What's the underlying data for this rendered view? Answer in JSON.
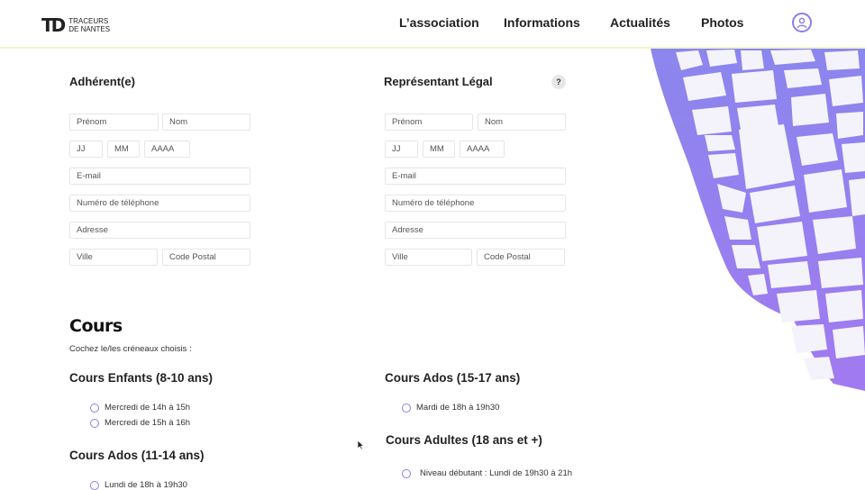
{
  "header": {
    "logo_mark": "TD",
    "logo_line1": "TRACEURS",
    "logo_line2": "DE NANTES",
    "nav": [
      "L’association",
      "Informations",
      "Actualités",
      "Photos"
    ]
  },
  "adherent": {
    "title": "Adhérent(e)",
    "prenom": "Prénom",
    "nom": "Nom",
    "jj": "JJ",
    "mm": "MM",
    "aaaa": "AAAA",
    "email": "E-mail",
    "telephone": "Numéro de téléphone",
    "adresse": "Adresse",
    "ville": "Ville",
    "code_postal": "Code Postal"
  },
  "representant": {
    "title": "Représentant Légal",
    "help": "?",
    "prenom": "Prénom",
    "nom": "Nom",
    "jj": "JJ",
    "mm": "MM",
    "aaaa": "AAAA",
    "email": "E-mail",
    "telephone": "Numéro de téléphone",
    "adresse": "Adresse",
    "ville": "Ville",
    "code_postal": "Code Postal"
  },
  "cours": {
    "title": "Cours",
    "subtitle": "Cochez le/les créneaux choisis :",
    "enfants": {
      "title": "Cours Enfants (8-10 ans)",
      "options": [
        "Mercredi de 14h à 15h",
        "Mercredi de 15h à 16h"
      ]
    },
    "ados_11": {
      "title": "Cours Ados (11-14 ans)",
      "options": [
        "Lundi de 18h à 19h30"
      ]
    },
    "ados_15": {
      "title": "Cours Ados (15-17 ans)",
      "options": [
        "Mardi de 18h à 19h30"
      ]
    },
    "adultes": {
      "title": "Cours Adultes (18 ans et +)",
      "options": [
        "Niveau débutant : Lundi de 19h30 à 21h"
      ]
    }
  },
  "colors": {
    "accent": "#8a7fe8",
    "map_gradient_top": "#8b86ee",
    "map_gradient_bottom": "#a17af0"
  },
  "icons": {
    "account": "user-circle-icon",
    "help": "question-icon"
  }
}
